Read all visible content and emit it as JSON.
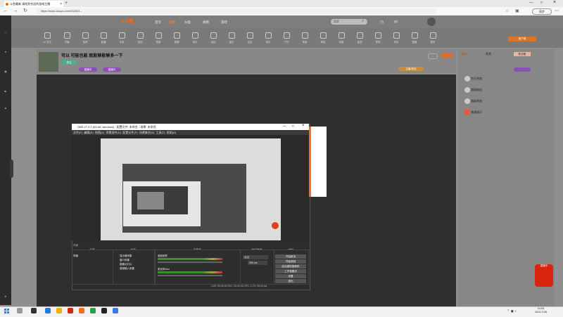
{
  "browser": {
    "tab_title": "斗鱼最新 请找到合适的游戏主播",
    "url": "https://www.douyu.com/432341...",
    "status_pill": "同步"
  },
  "site": {
    "menu": [
      "首页",
      "直播",
      "分类",
      "视频",
      "游戏"
    ],
    "search_placeholder": "搜索",
    "toolbar_items": [
      "12 关注",
      "开播",
      "鱼吧",
      "鱼塘",
      "手游",
      "游戏",
      "赛事",
      "视频",
      "排行",
      "活动",
      "娱乐",
      "社区",
      "音乐",
      "户外",
      "美食",
      "科技",
      "动漫",
      "影视",
      "体育",
      "资讯",
      "直播",
      "更多",
      "客户端",
      "设置"
    ]
  },
  "room": {
    "title": "可以 可能也能 就能够能够多一下",
    "follow_pill": "关注",
    "tag_pill": "直播中",
    "right_tag": "主播 粉丝"
  },
  "rightpanel": {
    "tabs": [
      "观众",
      "贵宾",
      "粉丝团"
    ],
    "rows": [
      "钻石贵宾",
      "超级粉丝",
      "超级贵宾",
      "普通观众"
    ]
  },
  "obs": {
    "title": "OBS 27.0.1 (64-bit, windows) - 配置文件: 未命名 - 场景: 未命名",
    "menu": [
      "文件(F)",
      "编辑(E)",
      "视图(V)",
      "停靠部件(D)",
      "配置文件(P)",
      "场景集合(S)",
      "工具(T)",
      "帮助(H)"
    ],
    "docks": [
      "场景",
      "来源",
      "混音器",
      "转场特效",
      "控制"
    ],
    "scene": "场景",
    "sources": [
      "显示器采集",
      "窗口采集",
      "图像幻灯片",
      "音频输入采集"
    ],
    "mixer": [
      "桌面音频",
      "麦克风/Aux"
    ],
    "transition": "淡出",
    "duration": "300 ms",
    "buttons": [
      "开始推流",
      "开始录制",
      "启动虚拟摄像机",
      "工作室模式",
      "设置",
      "退出"
    ],
    "statusbar": "LIVE: 00:00:00   REC: 00:00:00   CPU: 1.2%, 30.00 fps"
  },
  "taskbar": {
    "time": "14:03",
    "date": "2021/7/28"
  },
  "badge": "直播中"
}
